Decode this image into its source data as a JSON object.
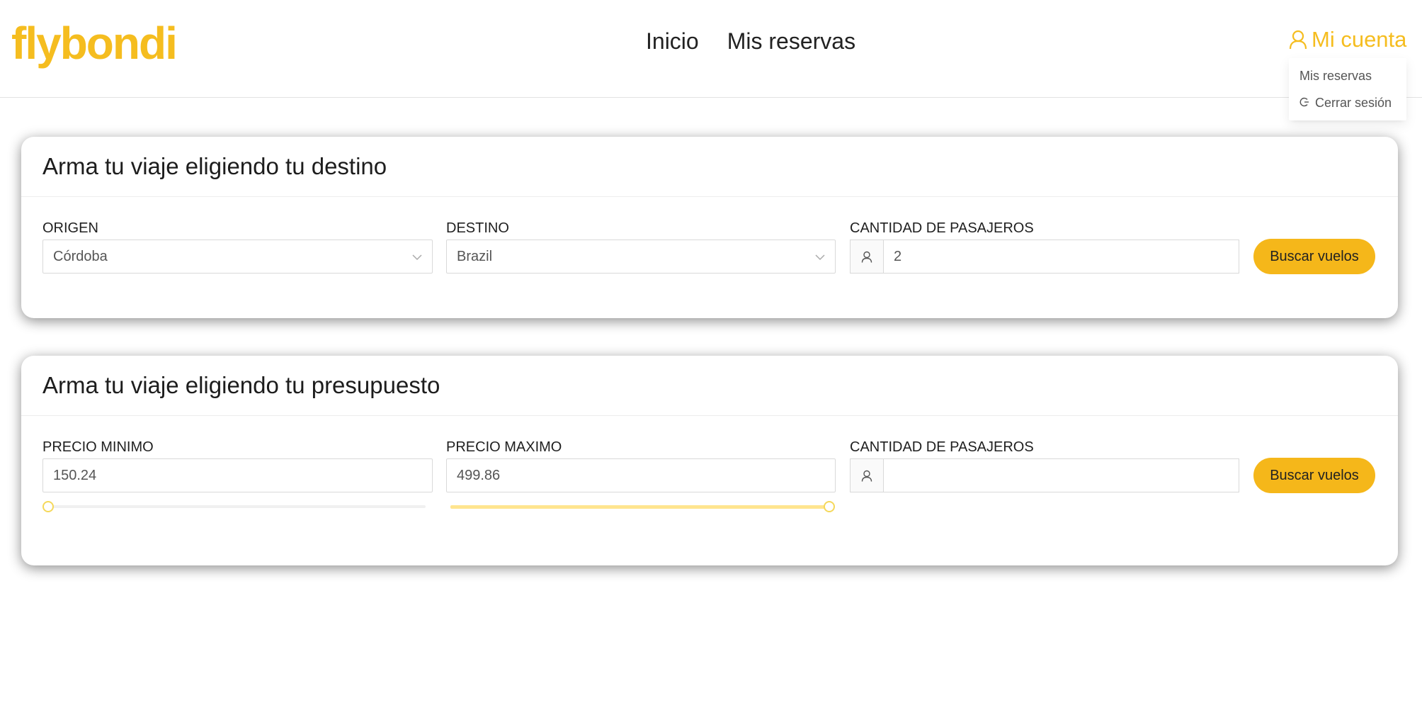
{
  "brand": {
    "logo_text": "flybondi",
    "color": "#f5bd1f"
  },
  "nav": {
    "inicio": "Inicio",
    "mis_reservas": "Mis reservas"
  },
  "account": {
    "label": "Mi cuenta",
    "icon": "user-icon",
    "menu": [
      {
        "label": "Mis reservas",
        "icon": ""
      },
      {
        "label": "Cerrar sesión",
        "icon": "logout-icon"
      }
    ]
  },
  "destination_card": {
    "title": "Arma tu viaje eligiendo tu destino",
    "origin": {
      "label": "ORIGEN",
      "value": "Córdoba"
    },
    "destination": {
      "label": "DESTINO",
      "value": "Brazil"
    },
    "passengers": {
      "label": "CANTIDAD DE PASAJEROS",
      "value": "2"
    },
    "search_button": "Buscar vuelos"
  },
  "budget_card": {
    "title": "Arma tu viaje eligiendo tu presupuesto",
    "min_price": {
      "label": "PRECIO MINIMO",
      "value": "150.24",
      "slider_fraction": 0.0
    },
    "max_price": {
      "label": "PRECIO MAXIMO",
      "value": "499.86",
      "slider_fraction": 1.0
    },
    "passengers": {
      "label": "CANTIDAD DE PASAJEROS",
      "value": ""
    },
    "search_button": "Buscar vuelos"
  },
  "colors": {
    "accent": "#f5b71a",
    "slider_track": "#ffe58f"
  }
}
